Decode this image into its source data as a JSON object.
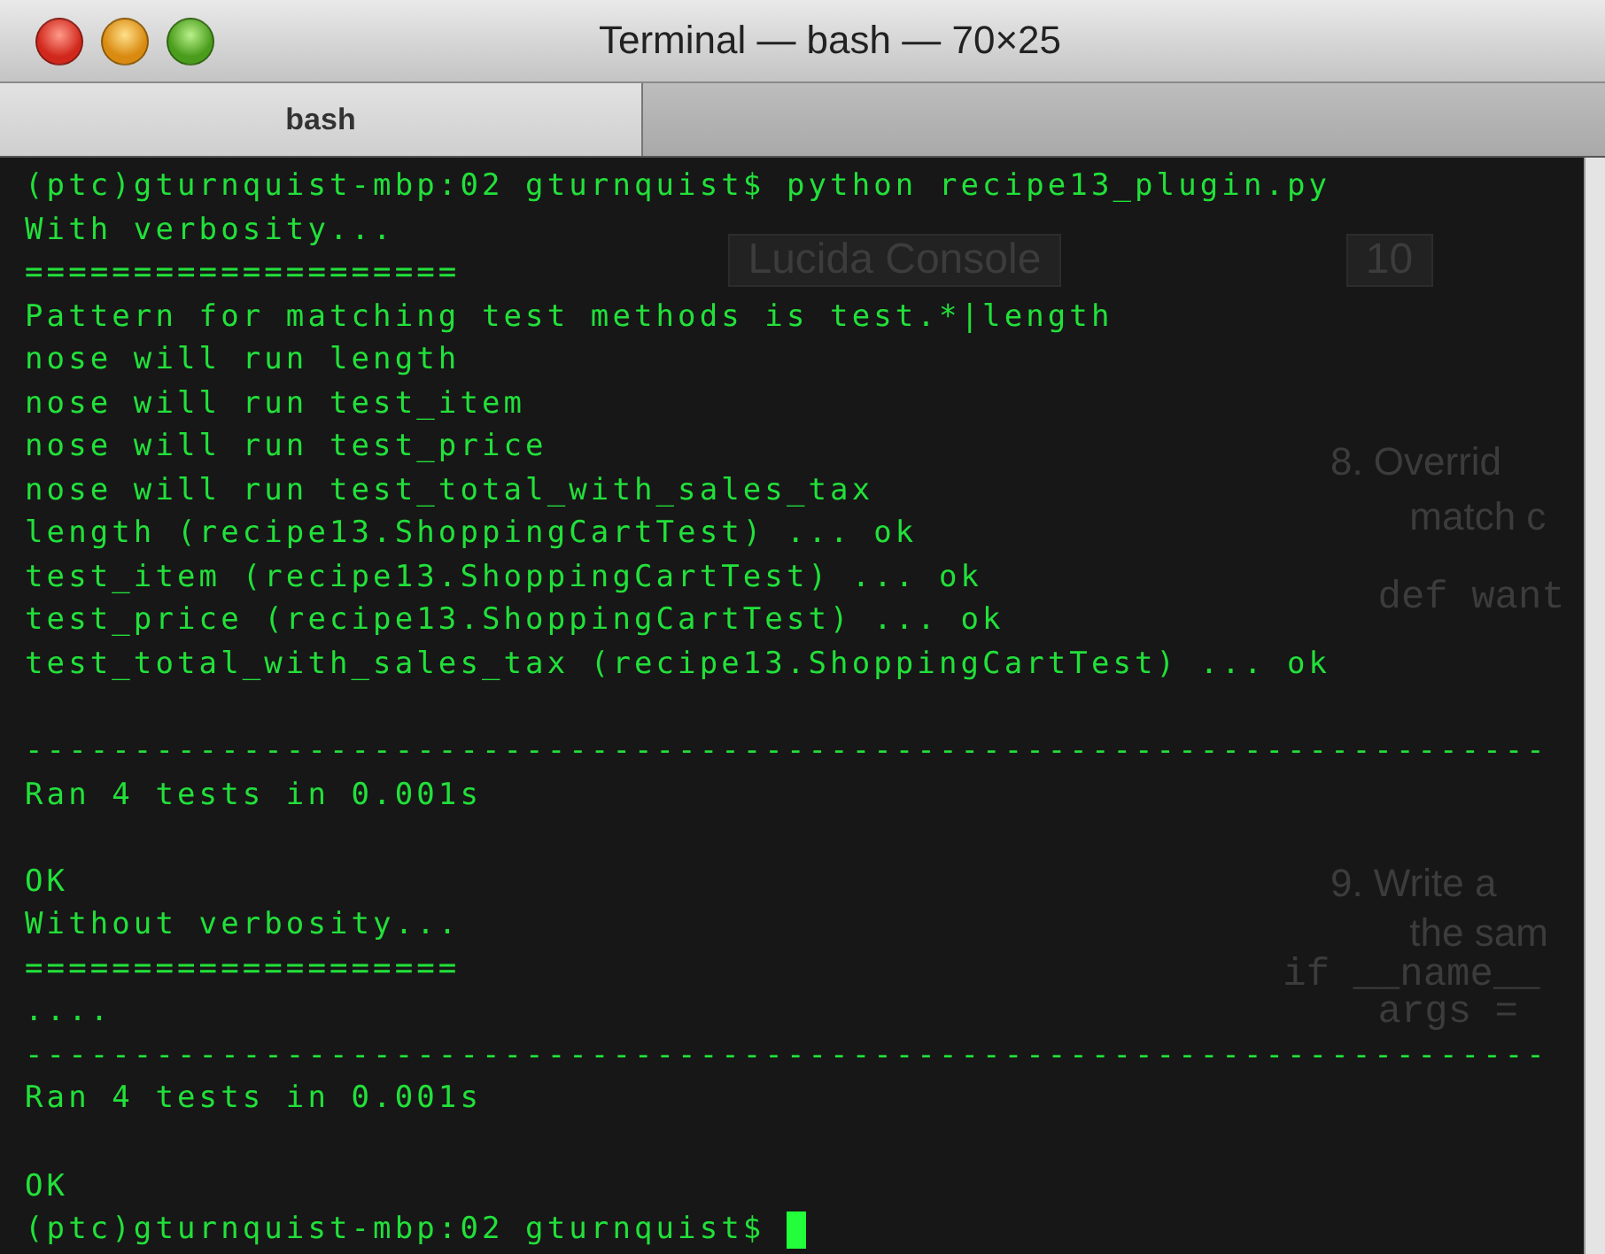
{
  "window": {
    "title": "Terminal — bash — 70×25"
  },
  "tabs": [
    {
      "label": "bash",
      "selected": true
    }
  ],
  "background_document": [
    {
      "text": "Lucida Console",
      "kind": "dropdown"
    },
    {
      "text": "10",
      "kind": "dropdown"
    },
    {
      "text": "8.  Overrid",
      "kind": "prose"
    },
    {
      "text": "match c",
      "kind": "prose"
    },
    {
      "text": "def want",
      "kind": "code"
    },
    {
      "text": "9.  Write a",
      "kind": "prose"
    },
    {
      "text": "the sam",
      "kind": "prose"
    },
    {
      "text": "if __name__",
      "kind": "code"
    },
    {
      "text": "args =",
      "kind": "code"
    }
  ],
  "lines": [
    {
      "kind": "text",
      "text": "(ptc)gturnquist-mbp:02 gturnquist$ python recipe13_plugin.py"
    },
    {
      "kind": "text",
      "text": "With verbosity..."
    },
    {
      "kind": "text",
      "text": "===================="
    },
    {
      "kind": "text",
      "text": "Pattern for matching test methods is test.*|length"
    },
    {
      "kind": "text",
      "text": "nose will run length"
    },
    {
      "kind": "text",
      "text": "nose will run test_item"
    },
    {
      "kind": "text",
      "text": "nose will run test_price"
    },
    {
      "kind": "text",
      "text": "nose will run test_total_with_sales_tax"
    },
    {
      "kind": "text",
      "text": "length (recipe13.ShoppingCartTest) ... ok"
    },
    {
      "kind": "text",
      "text": "test_item (recipe13.ShoppingCartTest) ... ok"
    },
    {
      "kind": "text",
      "text": "test_price (recipe13.ShoppingCartTest) ... ok"
    },
    {
      "kind": "text",
      "text": "test_total_with_sales_tax (recipe13.ShoppingCartTest) ... ok"
    },
    {
      "kind": "blank"
    },
    {
      "kind": "text",
      "text": "----------------------------------------------------------------------"
    },
    {
      "kind": "text",
      "text": "Ran 4 tests in 0.001s"
    },
    {
      "kind": "blank"
    },
    {
      "kind": "text",
      "text": "OK"
    },
    {
      "kind": "text",
      "text": "Without verbosity..."
    },
    {
      "kind": "text",
      "text": "===================="
    },
    {
      "kind": "text",
      "text": "...."
    },
    {
      "kind": "text",
      "text": "----------------------------------------------------------------------"
    },
    {
      "kind": "text",
      "text": "Ran 4 tests in 0.001s"
    },
    {
      "kind": "blank"
    },
    {
      "kind": "text",
      "text": "OK"
    },
    {
      "kind": "text",
      "text": "(ptc)gturnquist-mbp:02 gturnquist$ "
    }
  ],
  "cursor": {
    "visible": true
  }
}
